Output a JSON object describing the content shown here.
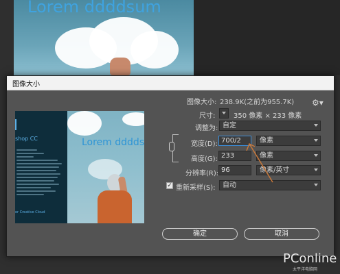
{
  "background": {
    "canvas_title": "Lorem ddddsum"
  },
  "dialog": {
    "title": "图像大小",
    "image_size_label": "图像大小:",
    "image_size_value": "238.9K(之前为955.7K)",
    "dimensions_label": "尺寸:",
    "dimensions_value": "350 像素 × 233 像素",
    "fit_to_label": "调整为:",
    "fit_to_value": "自定",
    "width_label": "宽度(D):",
    "width_value": "700/2",
    "width_unit": "像素",
    "height_label": "高度(G):",
    "height_value": "233",
    "height_unit": "像素",
    "resolution_label": "分辨率(R):",
    "resolution_value": "96",
    "resolution_unit": "像素/英寸",
    "resample_label": "重新采样(S):",
    "resample_checked": true,
    "resample_value": "自动",
    "ok_label": "确定",
    "cancel_label": "取消",
    "gear_icon": "gear-icon",
    "link_icon": "chain-link-icon"
  },
  "preview": {
    "lorem_text": "Lorem dddds",
    "app_text": "shop CC",
    "footer_text": "or Creative Cloud"
  },
  "watermark": {
    "brand": "PConline",
    "sub": "太平洋电脑网"
  },
  "colors": {
    "accent_blue": "#3b8cd8",
    "dialog_bg": "#535353",
    "arrow": "#c8783a"
  }
}
